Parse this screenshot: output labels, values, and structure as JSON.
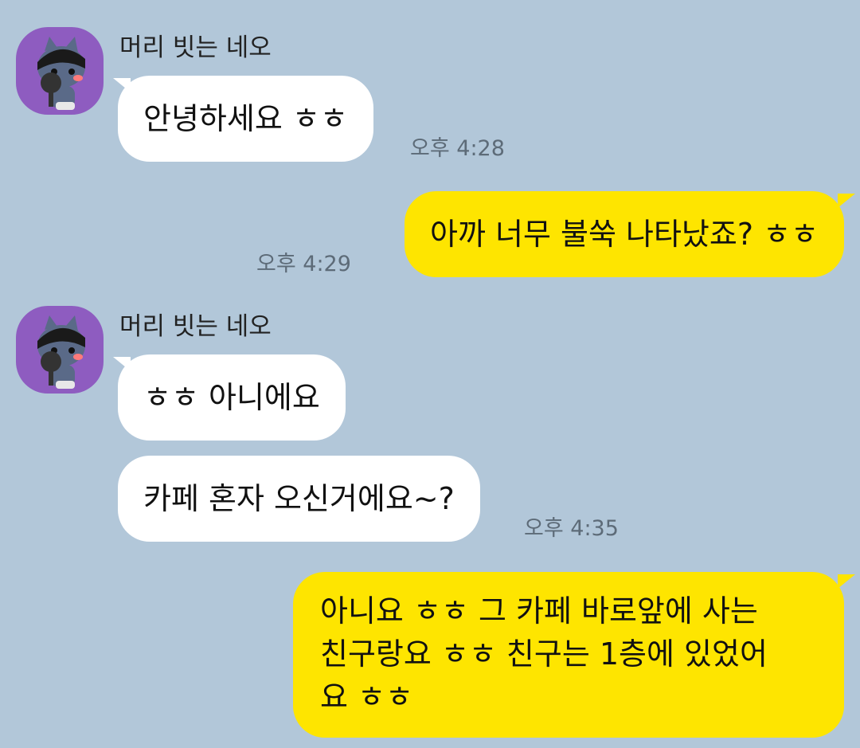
{
  "theme": {
    "background": "#b2c7d9",
    "received_bubble": "#ffffff",
    "sent_bubble": "#fee500",
    "avatar_bg": "#8e5cc0"
  },
  "messages": [
    {
      "sender": "머리 빗는 네오",
      "avatar_icon": "neo-character-avatar",
      "text": "안녕하세요 ㅎㅎ",
      "time": "오후 4:28",
      "direction": "received"
    },
    {
      "text": "아까 너무 불쑥 나타났죠? ㅎㅎ",
      "time": "오후 4:29",
      "direction": "sent"
    },
    {
      "sender": "머리 빗는 네오",
      "avatar_icon": "neo-character-avatar",
      "text": "ㅎㅎ 아니에요",
      "direction": "received"
    },
    {
      "text": "카페 혼자 오신거에요~?",
      "time": "오후 4:35",
      "direction": "received"
    },
    {
      "text_lines": [
        "아니요 ㅎㅎ 그 카페 바로앞에 사는",
        "친구랑요 ㅎㅎ 친구는 1층에 있었어",
        "요 ㅎㅎ"
      ],
      "direction": "sent"
    }
  ]
}
